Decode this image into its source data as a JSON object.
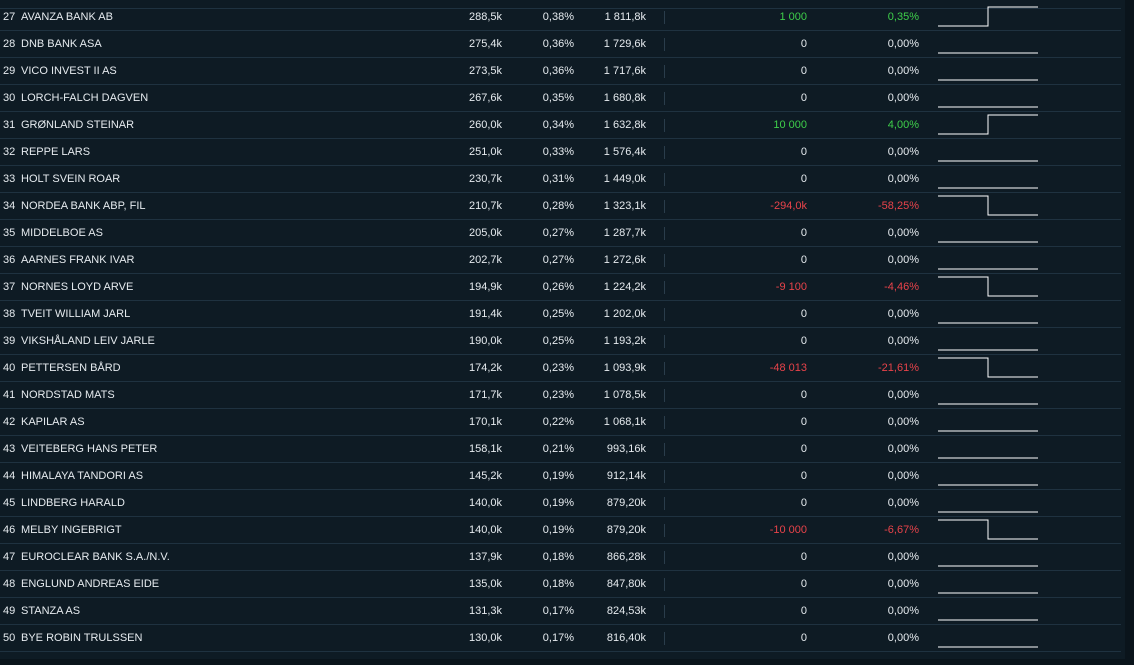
{
  "rows": [
    {
      "rank": "27",
      "name": "AVANZA BANK AB",
      "shares": "288,5k",
      "pct": "0,38%",
      "value": "1 811,8k",
      "change": "1 000",
      "change_pct": "0,35%",
      "trend": "up"
    },
    {
      "rank": "28",
      "name": "DNB BANK ASA",
      "shares": "275,4k",
      "pct": "0,36%",
      "value": "1 729,6k",
      "change": "0",
      "change_pct": "0,00%",
      "trend": "flat"
    },
    {
      "rank": "29",
      "name": "VICO INVEST II AS",
      "shares": "273,5k",
      "pct": "0,36%",
      "value": "1 717,6k",
      "change": "0",
      "change_pct": "0,00%",
      "trend": "flat"
    },
    {
      "rank": "30",
      "name": "LORCH-FALCH DAGVEN",
      "shares": "267,6k",
      "pct": "0,35%",
      "value": "1 680,8k",
      "change": "0",
      "change_pct": "0,00%",
      "trend": "flat"
    },
    {
      "rank": "31",
      "name": "GRØNLAND STEINAR",
      "shares": "260,0k",
      "pct": "0,34%",
      "value": "1 632,8k",
      "change": "10 000",
      "change_pct": "4,00%",
      "trend": "up"
    },
    {
      "rank": "32",
      "name": "REPPE LARS",
      "shares": "251,0k",
      "pct": "0,33%",
      "value": "1 576,4k",
      "change": "0",
      "change_pct": "0,00%",
      "trend": "flat"
    },
    {
      "rank": "33",
      "name": "HOLT SVEIN ROAR",
      "shares": "230,7k",
      "pct": "0,31%",
      "value": "1 449,0k",
      "change": "0",
      "change_pct": "0,00%",
      "trend": "flat"
    },
    {
      "rank": "34",
      "name": "NORDEA BANK ABP, FIL",
      "shares": "210,7k",
      "pct": "0,28%",
      "value": "1 323,1k",
      "change": "-294,0k",
      "change_pct": "-58,25%",
      "trend": "down"
    },
    {
      "rank": "35",
      "name": "MIDDELBOE AS",
      "shares": "205,0k",
      "pct": "0,27%",
      "value": "1 287,7k",
      "change": "0",
      "change_pct": "0,00%",
      "trend": "flat"
    },
    {
      "rank": "36",
      "name": "AARNES FRANK IVAR",
      "shares": "202,7k",
      "pct": "0,27%",
      "value": "1 272,6k",
      "change": "0",
      "change_pct": "0,00%",
      "trend": "flat"
    },
    {
      "rank": "37",
      "name": "NORNES LOYD ARVE",
      "shares": "194,9k",
      "pct": "0,26%",
      "value": "1 224,2k",
      "change": "-9 100",
      "change_pct": "-4,46%",
      "trend": "down"
    },
    {
      "rank": "38",
      "name": "TVEIT WILLIAM JARL",
      "shares": "191,4k",
      "pct": "0,25%",
      "value": "1 202,0k",
      "change": "0",
      "change_pct": "0,00%",
      "trend": "flat"
    },
    {
      "rank": "39",
      "name": "VIKSHÅLAND LEIV JARLE",
      "shares": "190,0k",
      "pct": "0,25%",
      "value": "1 193,2k",
      "change": "0",
      "change_pct": "0,00%",
      "trend": "flat"
    },
    {
      "rank": "40",
      "name": "PETTERSEN BÅRD",
      "shares": "174,2k",
      "pct": "0,23%",
      "value": "1 093,9k",
      "change": "-48 013",
      "change_pct": "-21,61%",
      "trend": "down"
    },
    {
      "rank": "41",
      "name": "NORDSTAD MATS",
      "shares": "171,7k",
      "pct": "0,23%",
      "value": "1 078,5k",
      "change": "0",
      "change_pct": "0,00%",
      "trend": "flat"
    },
    {
      "rank": "42",
      "name": "KAPILAR AS",
      "shares": "170,1k",
      "pct": "0,22%",
      "value": "1 068,1k",
      "change": "0",
      "change_pct": "0,00%",
      "trend": "flat"
    },
    {
      "rank": "43",
      "name": "VEITEBERG HANS PETER",
      "shares": "158,1k",
      "pct": "0,21%",
      "value": "993,16k",
      "change": "0",
      "change_pct": "0,00%",
      "trend": "flat"
    },
    {
      "rank": "44",
      "name": "HIMALAYA TANDORI AS",
      "shares": "145,2k",
      "pct": "0,19%",
      "value": "912,14k",
      "change": "0",
      "change_pct": "0,00%",
      "trend": "flat"
    },
    {
      "rank": "45",
      "name": "LINDBERG HARALD",
      "shares": "140,0k",
      "pct": "0,19%",
      "value": "879,20k",
      "change": "0",
      "change_pct": "0,00%",
      "trend": "flat"
    },
    {
      "rank": "46",
      "name": "MELBY INGEBRIGT",
      "shares": "140,0k",
      "pct": "0,19%",
      "value": "879,20k",
      "change": "-10 000",
      "change_pct": "-6,67%",
      "trend": "down"
    },
    {
      "rank": "47",
      "name": "EUROCLEAR BANK S.A./N.V.",
      "shares": "137,9k",
      "pct": "0,18%",
      "value": "866,28k",
      "change": "0",
      "change_pct": "0,00%",
      "trend": "flat"
    },
    {
      "rank": "48",
      "name": "ENGLUND ANDREAS EIDE",
      "shares": "135,0k",
      "pct": "0,18%",
      "value": "847,80k",
      "change": "0",
      "change_pct": "0,00%",
      "trend": "flat"
    },
    {
      "rank": "49",
      "name": "STANZA AS",
      "shares": "131,3k",
      "pct": "0,17%",
      "value": "824,53k",
      "change": "0",
      "change_pct": "0,00%",
      "trend": "flat"
    },
    {
      "rank": "50",
      "name": "BYE ROBIN TRULSSEN",
      "shares": "130,0k",
      "pct": "0,17%",
      "value": "816,40k",
      "change": "0",
      "change_pct": "0,00%",
      "trend": "flat"
    }
  ],
  "colors": {
    "background": "#0e1b24",
    "text": "#e6ebef",
    "positive": "#3ecf4a",
    "negative": "#e8434a",
    "divider": "#1f3240"
  }
}
